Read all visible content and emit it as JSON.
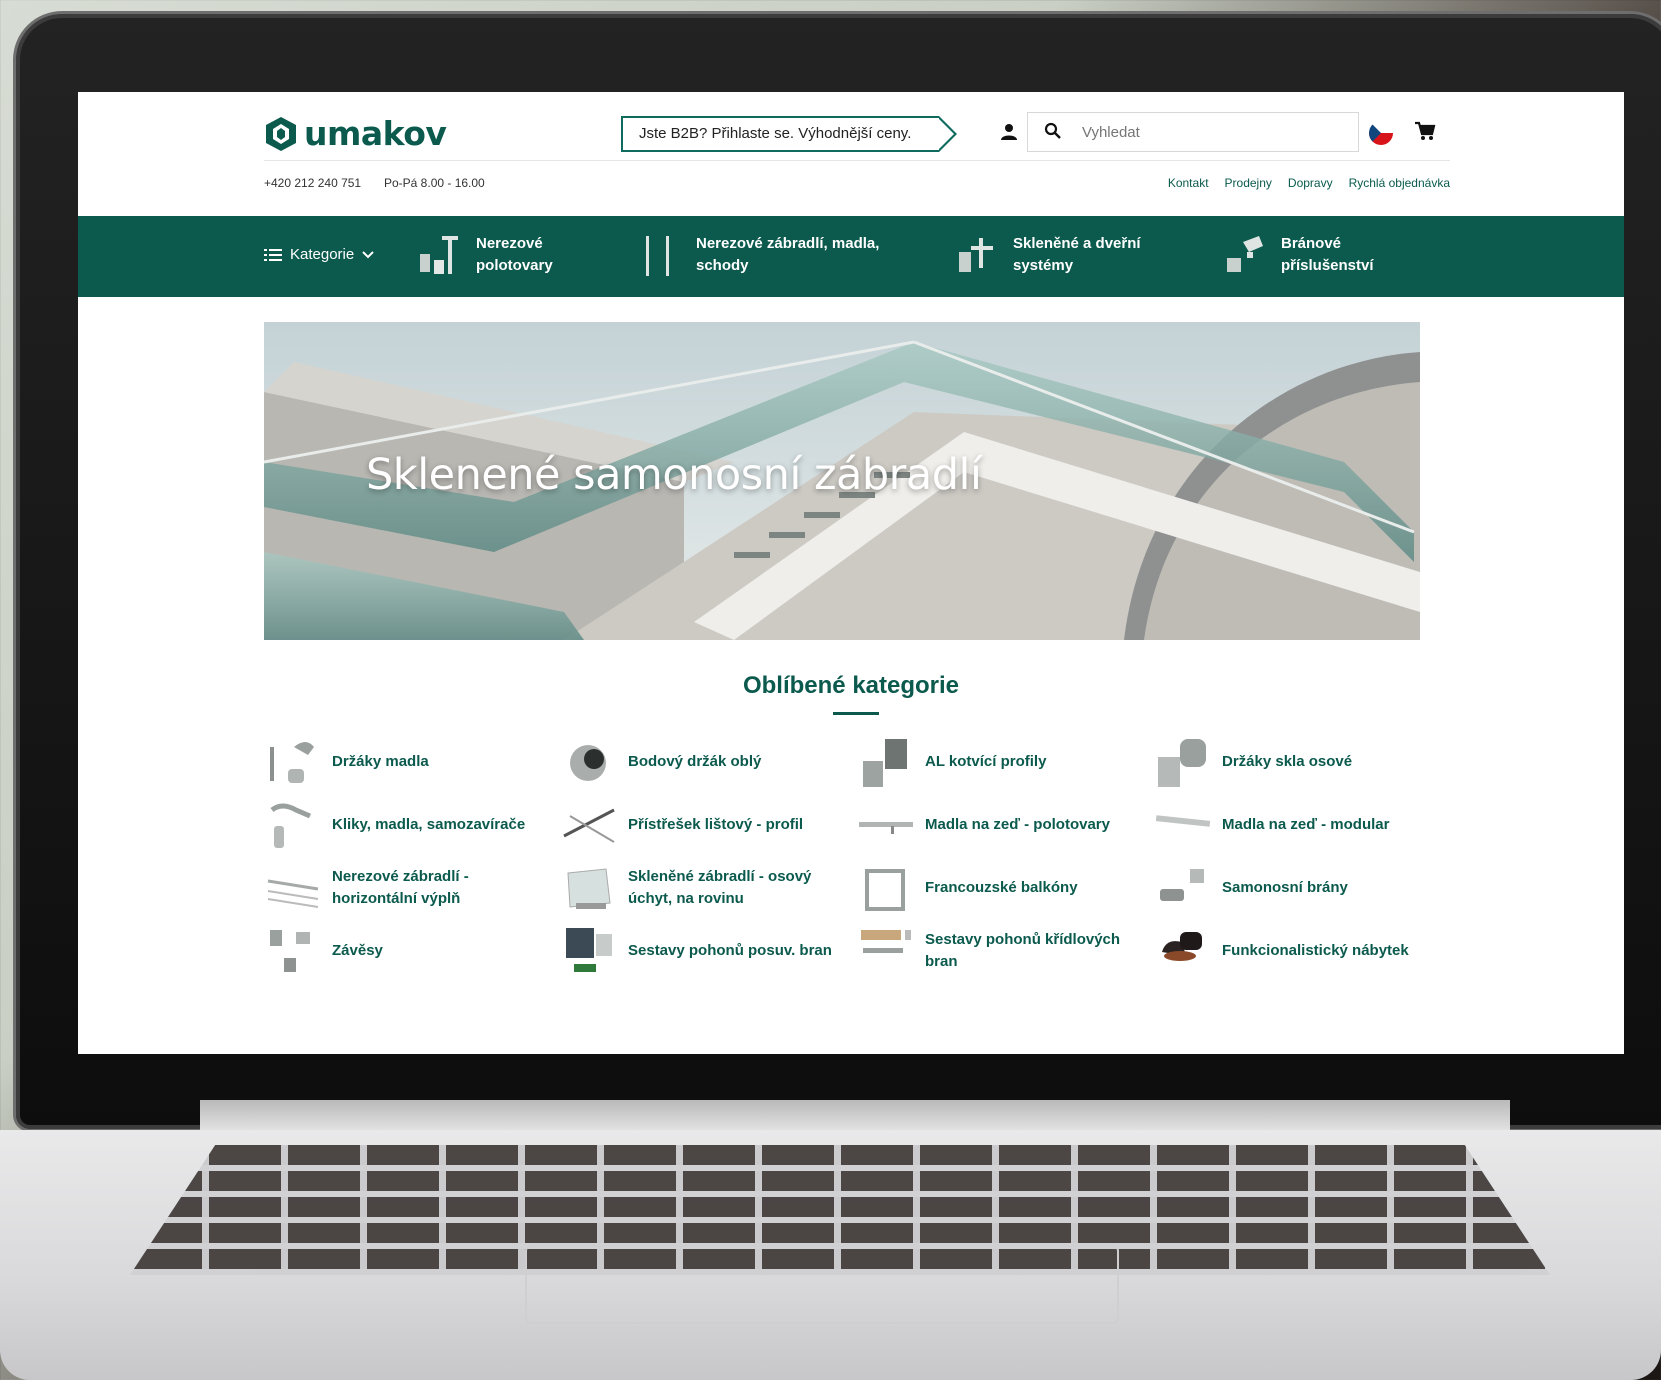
{
  "brand": {
    "name": "umakov",
    "accent": "#0b5a4d"
  },
  "header": {
    "b2b_cta": "Jste B2B? Přihlaste se. Výhodnější ceny.",
    "search_placeholder": "Vyhledat",
    "phone": "+420 212 240 751",
    "hours": "Po-Pá 8.00 - 16.00",
    "links": [
      "Kontakt",
      "Prodejny",
      "Dopravy",
      "Rychlá objednávka"
    ],
    "icons": [
      "user-icon",
      "search-icon",
      "czech-flag-icon",
      "cart-icon"
    ]
  },
  "nav": {
    "categories_label": "Kategorie",
    "items": [
      {
        "line1": "Nerezové",
        "line2": "polotovary"
      },
      {
        "line1": "Nerezové zábradlí, madla,",
        "line2": "schody"
      },
      {
        "line1": "Skleněné a dveřní",
        "line2": "systémy"
      },
      {
        "line1": "Bránové",
        "line2": "příslušenství"
      }
    ]
  },
  "hero": {
    "title": "Sklenené samonosní zábradlí"
  },
  "popular": {
    "title": "Oblíbené kategorie",
    "items": [
      "Držáky madla",
      "Bodový držák oblý",
      "AL kotvící profily",
      "Držáky skla osové",
      "Kliky, madla, samozavírače",
      "Přístřešek lištový - profil",
      "Madla na zeď - polotovary",
      "Madla na zeď - modular",
      "Nerezové zábradlí - horizontální výplň",
      "Skleněné zábradlí - osový úchyt, na rovinu",
      "Francouzské balkóny",
      "Samonosní brány",
      "Závěsy",
      "Sestavy pohonů posuv. bran",
      "Sestavy pohonů křídlových bran",
      "Funkcionalistický nábytek"
    ]
  }
}
